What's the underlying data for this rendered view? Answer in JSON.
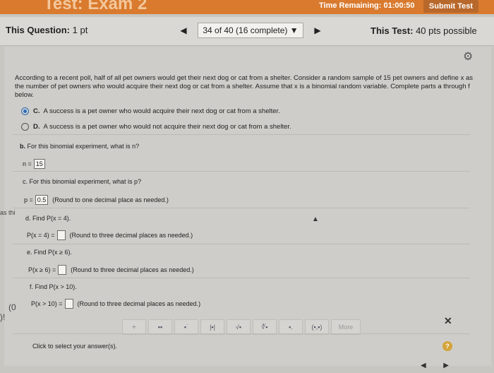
{
  "topbar": {
    "exam_title": "Test: Exam 2",
    "timer": "Time Remaining: 01:00:50",
    "submit_label": "Submit Test"
  },
  "header": {
    "this_question_label": "This Question:",
    "this_question_value": "1 pt",
    "counter": "34 of 40 (16 complete)",
    "counter_caret": "▼",
    "prev_arrow": "◀",
    "next_arrow": "▶",
    "this_test_label": "This Test:",
    "this_test_value": "40 pts possible"
  },
  "question": {
    "intro": "According to a recent poll, half of all pet owners would get their next dog or cat from a shelter. Consider a random sample of 15 pet owners and define x as the number of pet owners who would acquire their next dog or cat from a shelter. Assume that x is a binomial random variable. Complete parts a through f below.",
    "choices": [
      {
        "letter": "C.",
        "text": "A success is a pet owner who would acquire their next dog or cat from a shelter.",
        "selected": true
      },
      {
        "letter": "D.",
        "text": "A success is a pet owner who would not acquire their next dog or cat from a shelter.",
        "selected": false
      }
    ],
    "part_b": {
      "prompt_bold": "b.",
      "prompt": "For this binomial experiment, what is n?",
      "lhs": "n =",
      "answer": "15"
    },
    "part_c": {
      "prompt": "c. For this binomial experiment, what is p?",
      "lhs": "p =",
      "answer": "0.5",
      "hint": "(Round to one decimal place as needed.)"
    },
    "part_d": {
      "prompt": "d. Find P(x = 4).",
      "lhs": "P(x = 4) =",
      "answer": "",
      "hint": "(Round to three decimal places as needed.)"
    },
    "part_e": {
      "prompt": "e. Find P(x ≥ 6).",
      "lhs": "P(x ≥ 6) =",
      "answer": "",
      "hint": "(Round to three decimal places as needed.)"
    },
    "part_f": {
      "prompt": "f. Find P(x > 10).",
      "lhs": "P(x > 10) =",
      "answer": "",
      "hint": "(Round to three decimal places as needed.)"
    }
  },
  "toolbar": {
    "tools": [
      "÷",
      "▪▪",
      "▪˙",
      "|▪|",
      "√▪",
      "∜▪",
      "▪.",
      "(▪,▪)"
    ],
    "more_label": "More",
    "close": "✕"
  },
  "footer": {
    "select_msg": "Click to select your answer(s).",
    "help": "?",
    "prev": "◀",
    "next": "▶"
  },
  "stubs": {
    "left_stub1": "as thi",
    "left_stub2": "(0",
    "left_stub3": ")!"
  },
  "icons": {
    "gear": "gear-icon",
    "cursor": "mouse-pointer-icon"
  },
  "colors": {
    "topbar": "#d97a2e",
    "radio_selected": "#2a6ebb",
    "help_badge": "#d4a43a"
  }
}
